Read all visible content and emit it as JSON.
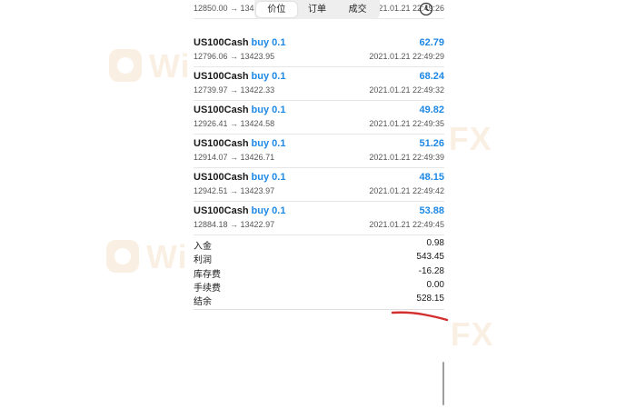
{
  "tabs": [
    {
      "label": "价位",
      "active": true
    },
    {
      "label": "订单",
      "active": false
    },
    {
      "label": "成交",
      "active": false
    }
  ],
  "cut_row": {
    "prices": "12850.00 → 13422.38",
    "time": "2021.01.21 22:49:26"
  },
  "deals": [
    {
      "symbol": "US100Cash",
      "side": "buy 0.1",
      "prices": "12796.06 → 13423.95",
      "profit": "62.79",
      "time": "2021.01.21 22:49:29"
    },
    {
      "symbol": "US100Cash",
      "side": "buy 0.1",
      "prices": "12739.97 → 13422.33",
      "profit": "68.24",
      "time": "2021.01.21 22:49:32"
    },
    {
      "symbol": "US100Cash",
      "side": "buy 0.1",
      "prices": "12926.41 → 13424.58",
      "profit": "49.82",
      "time": "2021.01.21 22:49:35"
    },
    {
      "symbol": "US100Cash",
      "side": "buy 0.1",
      "prices": "12914.07 → 13426.71",
      "profit": "51.26",
      "time": "2021.01.21 22:49:39"
    },
    {
      "symbol": "US100Cash",
      "side": "buy 0.1",
      "prices": "12942.51 → 13423.97",
      "profit": "48.15",
      "time": "2021.01.21 22:49:42"
    },
    {
      "symbol": "US100Cash",
      "side": "buy 0.1",
      "prices": "12884.18 → 13422.97",
      "profit": "53.88",
      "time": "2021.01.21 22:49:45"
    }
  ],
  "summary": [
    {
      "label": "入金",
      "value": "0.98"
    },
    {
      "label": "利润",
      "value": "543.45"
    },
    {
      "label": "库存费",
      "value": "-16.28"
    },
    {
      "label": "手续费",
      "value": "0.00"
    },
    {
      "label": "结余",
      "value": "528.15"
    }
  ],
  "watermark": {
    "text": "WikiFX"
  },
  "colors": {
    "profit": "#1e88e5",
    "side": "#1e88e5",
    "annotation": "#d32f2f",
    "watermark": "#e8a86a"
  },
  "icons": {
    "history": "clock-icon",
    "watermark_logo": "wikifx-logo-icon",
    "annotation": "red-underline-mark"
  }
}
